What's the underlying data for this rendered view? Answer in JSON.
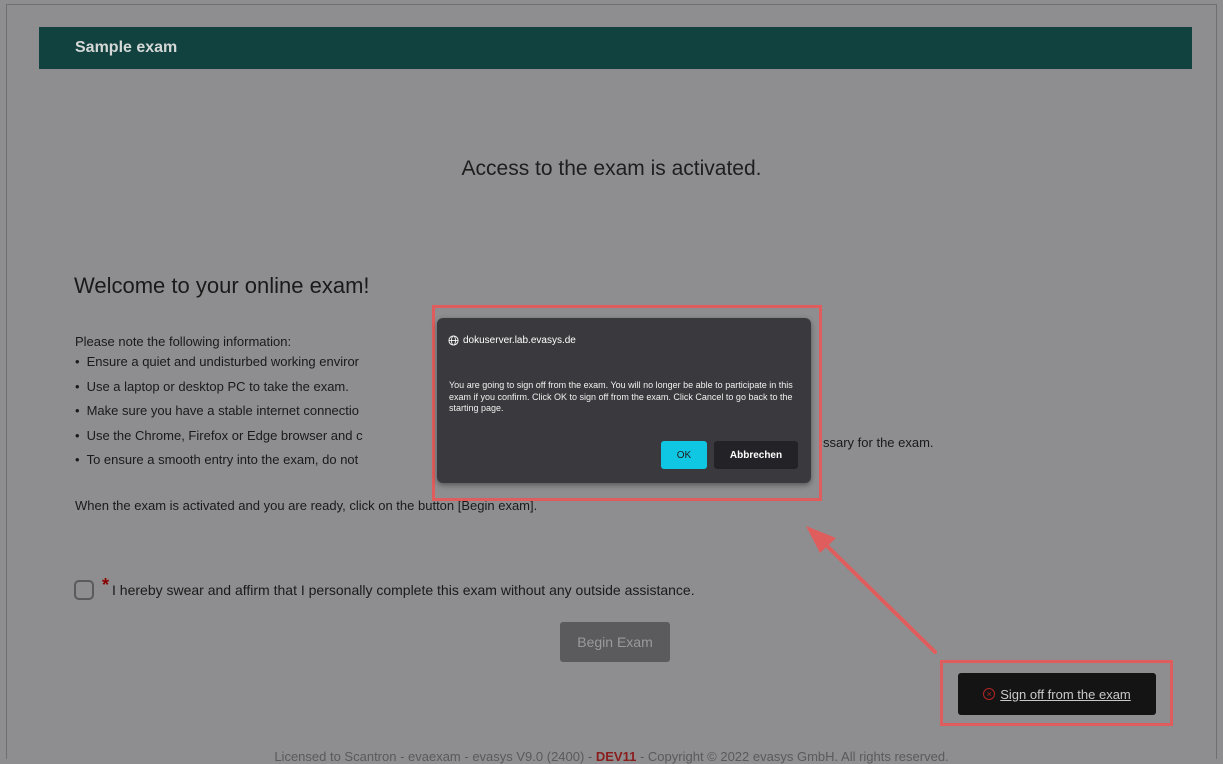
{
  "header": {
    "title": "Sample exam"
  },
  "main": {
    "access_message": "Access to the exam is activated.",
    "welcome_heading": "Welcome to your online exam!",
    "note_intro": "Please note the following information:",
    "bullets": [
      "Ensure a quiet and undisturbed working enviror",
      "Use a laptop or desktop PC to take the exam.",
      "Make sure you have a stable internet connectio",
      "Use the Chrome, Firefox or Edge browser and c",
      "To ensure a smooth entry into the exam, do not"
    ],
    "bullet_4_continuation": "ssary for the exam.",
    "activated_instruction": "When the exam is activated and you are ready, click on the button [Begin exam].",
    "oath_star": "*",
    "oath_text": "I hereby swear and affirm that I personally complete this exam without any outside assistance.",
    "begin_button": "Begin Exam"
  },
  "signoff": {
    "label": "Sign off from the exam",
    "icon": "close-circle-icon"
  },
  "footer": {
    "text_before": "Licensed to Scantron - evaexam - evasys V9.0 (2400) - ",
    "dev": "DEV11",
    "text_after": " - Copyright © 2022 evasys GmbH. All rights reserved."
  },
  "dialog": {
    "origin": "dokuserver.lab.evasys.de",
    "message": "You are going to sign off from the exam. You will no longer be able to participate in this exam if you confirm. Click OK to sign off from the exam. Click Cancel to go back to the starting page.",
    "ok_label": "OK",
    "cancel_label": "Abbrechen"
  },
  "colors": {
    "header_bg": "#12423f",
    "overlay_bg": "#8e8e90",
    "dialog_bg": "#3a393d",
    "ok_button": "#0fc6e3",
    "highlight": "#e05d5d",
    "dev_text": "#8b1d1d"
  }
}
